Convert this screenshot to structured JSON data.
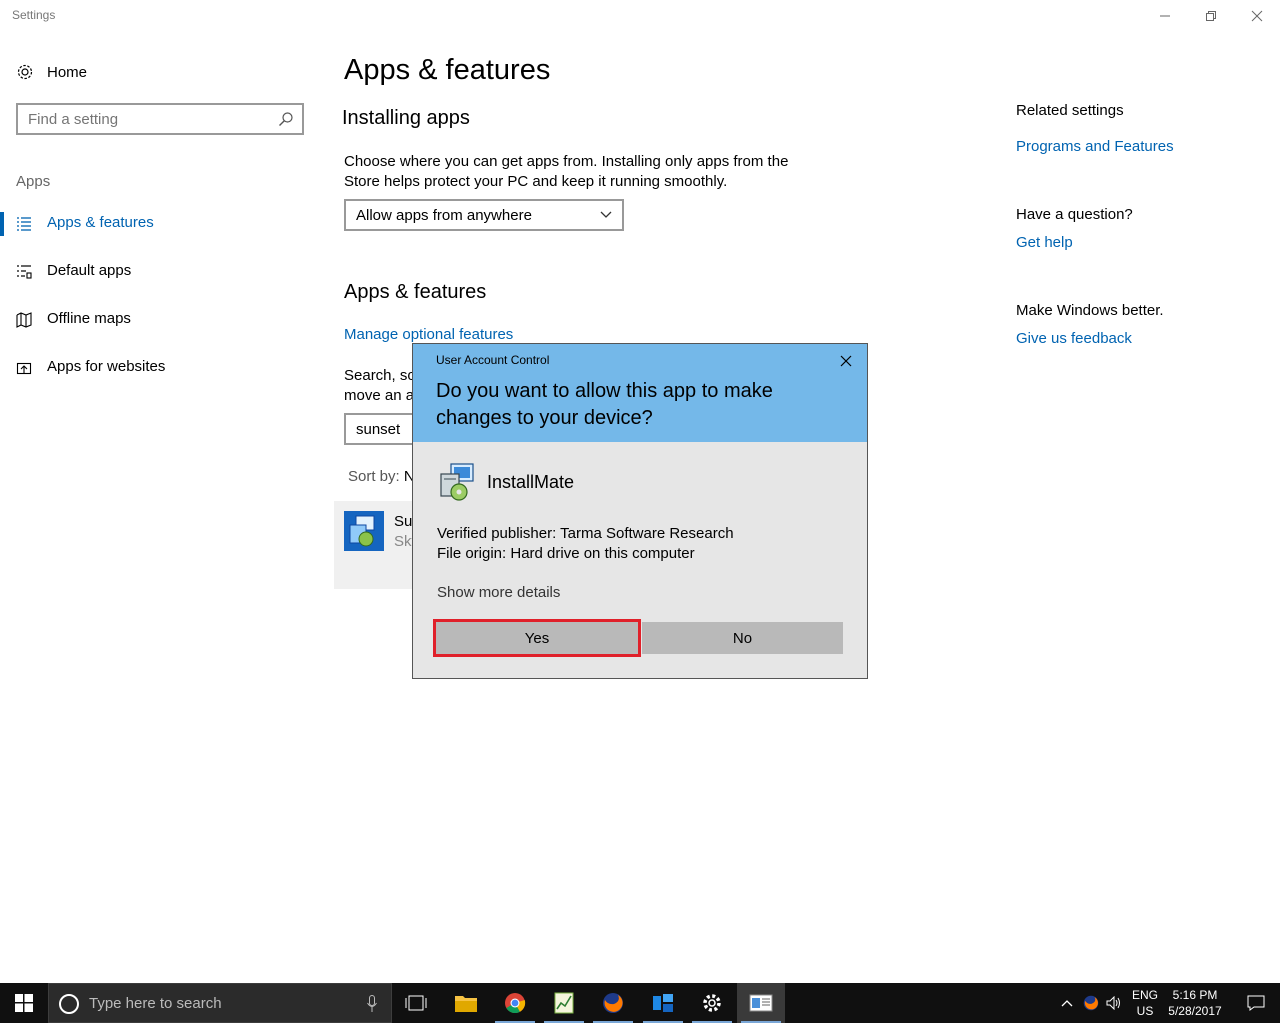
{
  "window": {
    "title": "Settings",
    "controls": {
      "minimize": "minimize",
      "restore": "restore",
      "close": "close"
    }
  },
  "sidebar": {
    "home_label": "Home",
    "search_placeholder": "Find a setting",
    "section_label": "Apps",
    "items": [
      {
        "label": "Apps & features",
        "icon": "list-icon",
        "active": true
      },
      {
        "label": "Default apps",
        "icon": "default-apps-icon",
        "active": false
      },
      {
        "label": "Offline maps",
        "icon": "map-icon",
        "active": false
      },
      {
        "label": "Apps for websites",
        "icon": "open-in-icon",
        "active": false
      }
    ]
  },
  "main": {
    "title": "Apps & features",
    "installing": {
      "heading": "Installing apps",
      "description": "Choose where you can get apps from. Installing only apps from the Store helps protect your PC and keep it running smoothly.",
      "dropdown_value": "Allow apps from anywhere"
    },
    "apps_features": {
      "heading": "Apps & features",
      "manage_link": "Manage optional features",
      "search_desc_line1": "Search, so",
      "search_desc_line2": "move an a",
      "search_value": "sunset",
      "sort_label": "Sort by:",
      "sort_value": "N",
      "app_name_partial": "Su",
      "app_publisher_partial": "Sky"
    }
  },
  "related": {
    "heading": "Related settings",
    "programs_link": "Programs and Features",
    "question_heading": "Have a question?",
    "help_link": "Get help",
    "better_heading": "Make Windows better.",
    "feedback_link": "Give us feedback"
  },
  "uac": {
    "caption": "User Account Control",
    "question": "Do you want to allow this app to make changes to your device?",
    "app_name": "InstallMate",
    "publisher_line": "Verified publisher: Tarma Software Research",
    "origin_line": "File origin: Hard drive on this computer",
    "more_details": "Show more details",
    "yes_label": "Yes",
    "no_label": "No",
    "colors": {
      "header": "#74b8e9",
      "body": "#e6e6e6",
      "highlight": "#e0202a"
    }
  },
  "taskbar": {
    "search_placeholder": "Type here to search",
    "apps": [
      "task-view-icon",
      "file-explorer-icon",
      "chrome-icon",
      "notepad-chart-icon",
      "firefox-icon",
      "installer-icon",
      "settings-icon",
      "window-app-icon"
    ],
    "tray": {
      "language_top": "ENG",
      "language_bottom": "US",
      "time": "5:16 PM",
      "date": "5/28/2017"
    }
  },
  "accent_color": "#0063b1"
}
